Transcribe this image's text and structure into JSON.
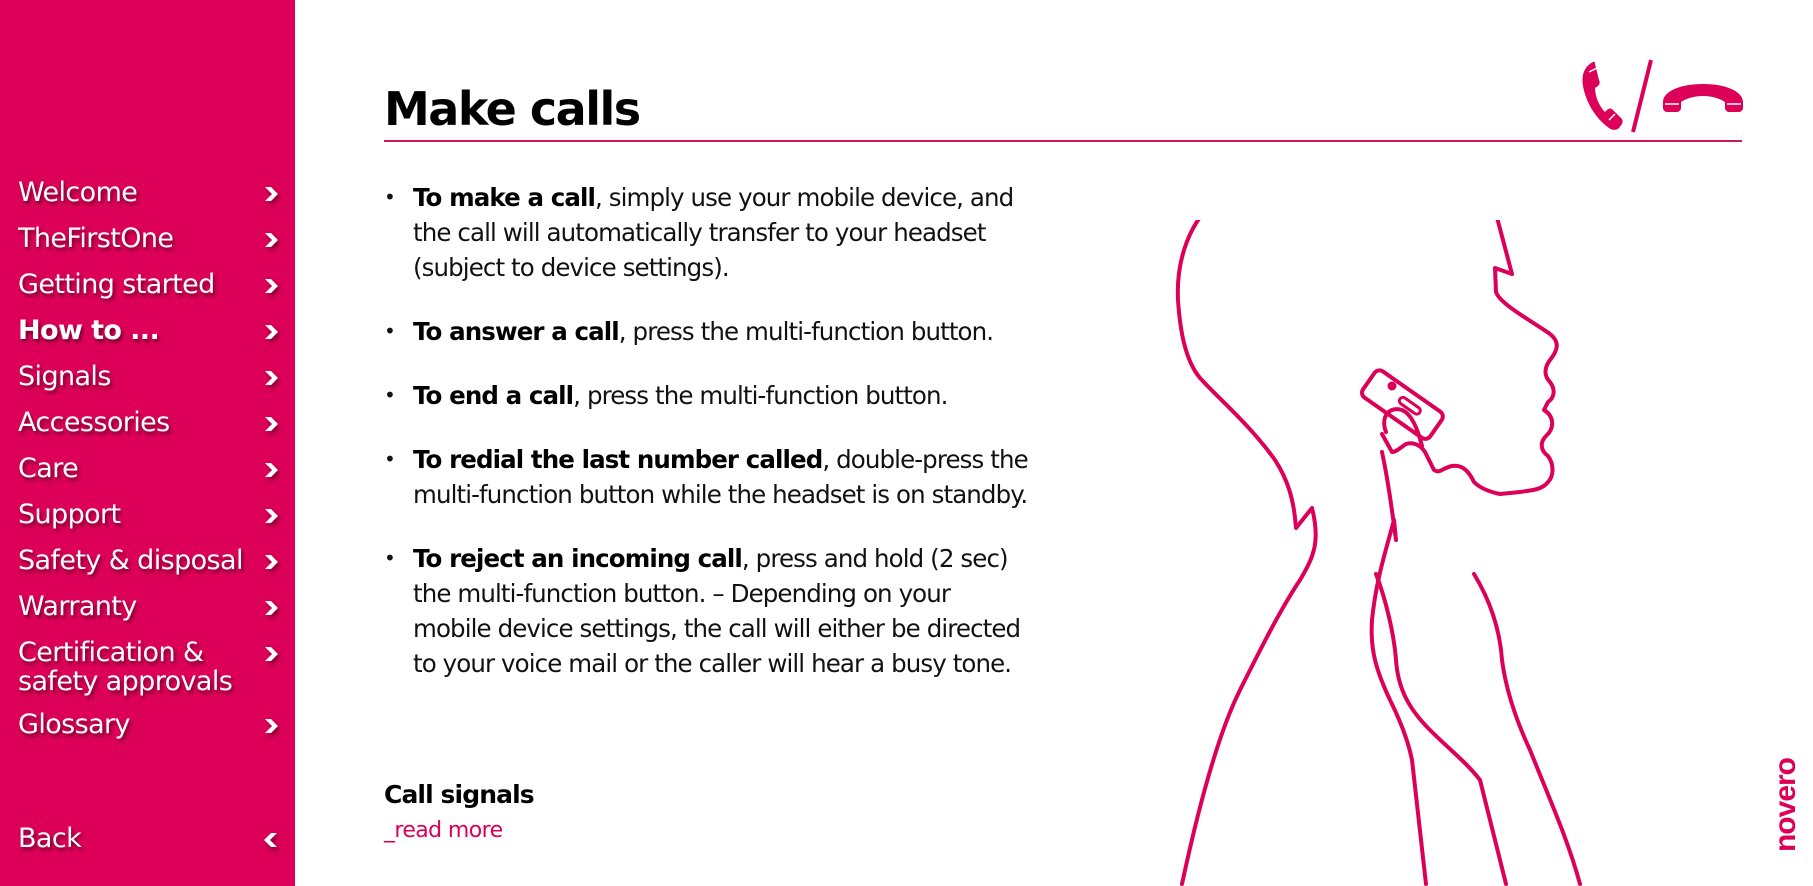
{
  "sidebar": {
    "items": [
      {
        "label": "Welcome",
        "active": false
      },
      {
        "label": "TheFirstOne",
        "active": false
      },
      {
        "label": "Getting started",
        "active": false
      },
      {
        "label": "How to ...",
        "active": true
      },
      {
        "label": "Signals",
        "active": false
      },
      {
        "label": "Accessories",
        "active": false
      },
      {
        "label": "Care",
        "active": false
      },
      {
        "label": "Support",
        "active": false
      },
      {
        "label": "Safety & disposal",
        "active": false
      },
      {
        "label": "Warranty",
        "active": false
      },
      {
        "label": "Certification &\nsafety approvals",
        "active": false
      },
      {
        "label": "Glossary",
        "active": false
      }
    ],
    "back_label": "Back",
    "icons": {
      "item": "chevron-right-icon",
      "back": "chevron-left-icon"
    }
  },
  "page": {
    "title": "Make calls",
    "header_icons": [
      "phone-pickup-icon",
      "slash-divider",
      "phone-hangup-icon"
    ],
    "bullets": [
      {
        "bold": "To make a call",
        "text": ", simply use your mobile device, and the call will automatically transfer to your headset (subject to device settings)."
      },
      {
        "bold": "To answer a call",
        "text": ", press the multi-function button."
      },
      {
        "bold": "To end a call",
        "text": ", press the multi-function button."
      },
      {
        "bold": "To redial the last number called",
        "text": ", double-press the multi-function button while the headset is on standby."
      },
      {
        "bold": "To reject an incoming call",
        "text": ", press and hold (2 sec) the multi-function button. – Depending on your mobile device settings, the call will either be directed to your voice mail or the caller will hear a busy tone."
      }
    ],
    "subheading": "Call signals",
    "read_more": "_read more",
    "illustration": "person-using-headset-illustration"
  },
  "brand": {
    "name": "novero",
    "color": "#dc0058"
  },
  "colors": {
    "accent": "#dc0058",
    "rule": "#c8185a",
    "text": "#111111"
  }
}
